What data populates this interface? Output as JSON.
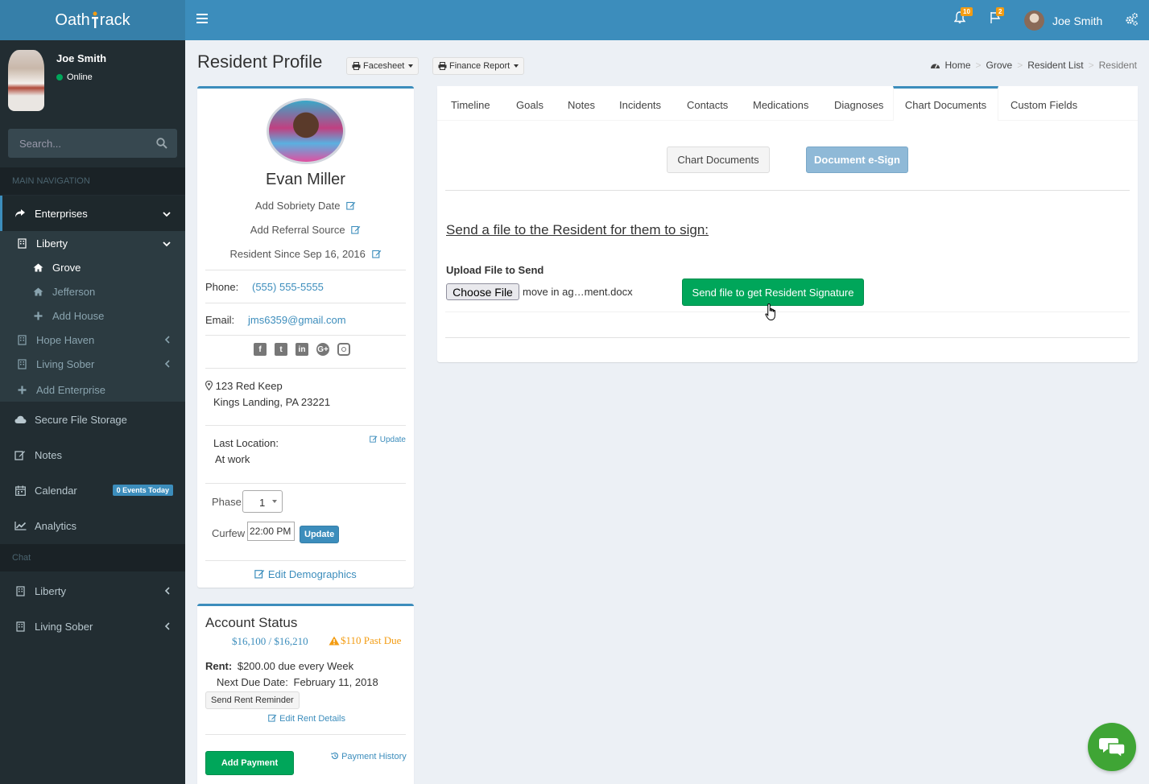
{
  "app": {
    "logo_left": "Oath",
    "logo_right": "rack"
  },
  "header": {
    "notifications_count": "10",
    "flags_count": "2",
    "user_name": "Joe Smith"
  },
  "sidebar": {
    "user_name": "Joe Smith",
    "user_status": "Online",
    "search_placeholder": "Search...",
    "main_nav_label": "MAIN NAVIGATION",
    "chat_label": "Chat",
    "enterprises": "Enterprises",
    "liberty": "Liberty",
    "grove": "Grove",
    "jefferson": "Jefferson",
    "add_house": "Add House",
    "hope_haven": "Hope Haven",
    "living_sober": "Living Sober",
    "add_enterprise": "Add Enterprise",
    "secure_file_storage": "Secure File Storage",
    "notes": "Notes",
    "calendar": "Calendar",
    "events_badge": "0 Events Today",
    "analytics": "Analytics",
    "chat_liberty": "Liberty",
    "chat_living_sober": "Living Sober"
  },
  "page": {
    "title": "Resident Profile",
    "facesheet": "Facesheet",
    "finance_report": "Finance Report",
    "breadcrumb": [
      "Home",
      "Grove",
      "Resident List",
      "Resident"
    ]
  },
  "profile": {
    "name": "Evan Miller",
    "add_sobriety": "Add Sobriety Date",
    "add_referral": "Add Referral Source",
    "resident_since": "Resident Since Sep 16, 2016",
    "phone_label": "Phone:",
    "phone": "(555) 555-5555",
    "email_label": "Email:",
    "email": "jms6359@gmail.com",
    "address_line1": "123 Red Keep",
    "address_line2": "Kings Landing, PA 23221",
    "last_location_label": "Last Location:",
    "last_location": "At work",
    "update_link": "Update",
    "phase_label": "Phase",
    "phase_value": "1",
    "curfew_label": "Curfew",
    "curfew_value": "22:00 PM",
    "update_button": "Update",
    "edit_demographics": "Edit Demographics"
  },
  "account": {
    "title": "Account Status",
    "balance": "$16,100 / $16,210",
    "past_due": "$110 Past Due",
    "rent_label": "Rent:",
    "rent_value": "$200.00 due every Week",
    "next_due_label": "Next Due Date:",
    "next_due_value": "February 11, 2018",
    "send_reminder": "Send Rent Reminder",
    "edit_rent": "Edit Rent Details",
    "add_payment": "Add Payment",
    "payment_history": "Payment History"
  },
  "tabs": [
    "Timeline",
    "Goals",
    "Notes",
    "Incidents",
    "Contacts",
    "Medications",
    "Diagnoses",
    "Chart Documents",
    "Custom Fields"
  ],
  "chart_docs": {
    "chart_documents_btn": "Chart Documents",
    "esign_btn": "Document e-Sign",
    "heading": "Send a file to the Resident for them to sign:",
    "upload_label": "Upload File to Send",
    "choose_file": "Choose File",
    "file_name": "move in ag…ment.docx",
    "send_button": "Send file to get Resident Signature"
  },
  "colors": {
    "header_blue": "#3c8dbc",
    "logo_blue": "#367fa9",
    "sidebar_dark": "#222d32",
    "green": "#00a65a",
    "warning": "#f39c12"
  }
}
